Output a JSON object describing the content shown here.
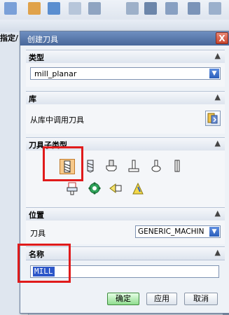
{
  "dialog": {
    "title": "创建刀具",
    "close_label": "X",
    "sections": {
      "type": {
        "label": "类型",
        "select_value": "mill_planar"
      },
      "library": {
        "label": "库",
        "retrieve_label": "从库中调用刀具"
      },
      "subtype": {
        "label": "刀具子类型"
      },
      "location": {
        "label": "位置",
        "tool_label": "刀具",
        "tool_value": "GENERIC_MACHIN"
      },
      "name": {
        "label": "名称",
        "value": "MILL"
      }
    },
    "buttons": {
      "ok": "确定",
      "apply": "应用",
      "cancel": "取消"
    }
  },
  "background": {
    "left_panel_label": "指定/"
  },
  "colors": {
    "highlight": "#e01b1b",
    "title_bar": "#48679a",
    "selection": "#2d57c9"
  }
}
